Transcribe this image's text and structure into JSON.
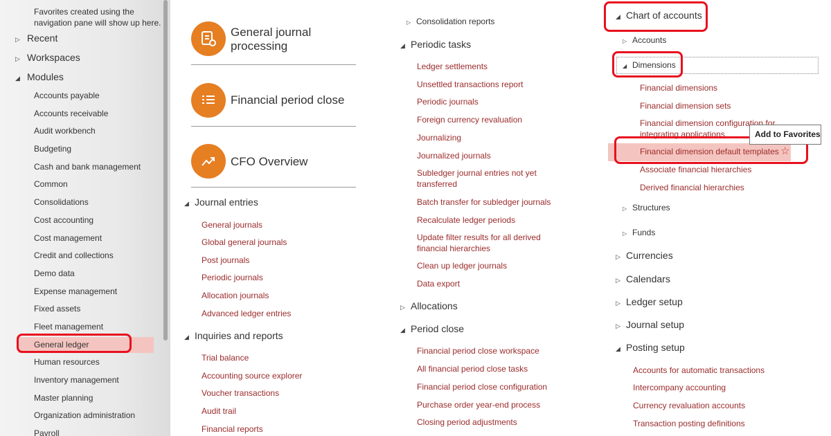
{
  "nav": {
    "favorites_hint": "Favorites created using the navigation pane will show up here.",
    "recent": "Recent",
    "workspaces": "Workspaces",
    "modules": "Modules",
    "module_items": [
      "Accounts payable",
      "Accounts receivable",
      "Audit workbench",
      "Budgeting",
      "Cash and bank management",
      "Common",
      "Consolidations",
      "Cost accounting",
      "Cost management",
      "Credit and collections",
      "Demo data",
      "Expense management",
      "Fixed assets",
      "Fleet management",
      "General ledger",
      "Human resources",
      "Inventory management",
      "Master planning",
      "Organization administration",
      "Payroll"
    ],
    "selected_module": "General ledger"
  },
  "tiles": {
    "gjp": "General journal processing",
    "fpc": "Financial period close",
    "cfo": "CFO Overview"
  },
  "col1": {
    "journal_entries": "Journal entries",
    "journal_links": [
      "General journals",
      "Global general journals",
      "Post journals",
      "Periodic journals",
      "Allocation journals",
      "Advanced ledger entries"
    ],
    "inquiries": "Inquiries and reports",
    "inquiry_links": [
      "Trial balance",
      "Accounting source explorer",
      "Voucher transactions",
      "Audit trail",
      "Financial reports"
    ]
  },
  "col2": {
    "consolidation_reports": "Consolidation reports",
    "periodic_tasks": "Periodic tasks",
    "periodic_links": [
      "Ledger settlements",
      "Unsettled transactions report",
      "Periodic journals",
      "Foreign currency revaluation",
      "Journalizing",
      "Journalized journals",
      "Subledger journal entries not yet transferred",
      "Batch transfer for subledger journals",
      "Recalculate ledger periods",
      "Update filter results for all derived financial hierarchies",
      "Clean up ledger journals",
      "Data export"
    ],
    "allocations": "Allocations",
    "period_close": "Period close",
    "period_links": [
      "Financial period close workspace",
      "All financial period close tasks",
      "Financial period close configuration",
      "Purchase order year-end process",
      "Closing period adjustments"
    ]
  },
  "col3": {
    "chart_of_accounts": "Chart of accounts",
    "accounts": "Accounts",
    "dimensions": "Dimensions",
    "dimension_links": [
      "Financial dimensions",
      "Financial dimension sets",
      "Financial dimension configuration for integrating applications",
      "Financial dimension default templates",
      "Associate financial hierarchies",
      "Derived financial hierarchies"
    ],
    "structures": "Structures",
    "funds": "Funds",
    "currencies": "Currencies",
    "calendars": "Calendars",
    "ledger_setup": "Ledger setup",
    "journal_setup": "Journal setup",
    "posting_setup": "Posting setup",
    "posting_links": [
      "Accounts for automatic transactions",
      "Intercompany accounting",
      "Currency revaluation accounts",
      "Transaction posting definitions"
    ],
    "tooltip": "Add to Favorites"
  },
  "colors": {
    "link": "#9b2b2b",
    "tile": "#e67e22",
    "highlight_box": "#e8101e",
    "selection": "#f4c5c0"
  },
  "icons": {
    "collapsed": "triangle-right-icon",
    "expanded": "triangle-down-icon",
    "favorite": "star-icon"
  }
}
